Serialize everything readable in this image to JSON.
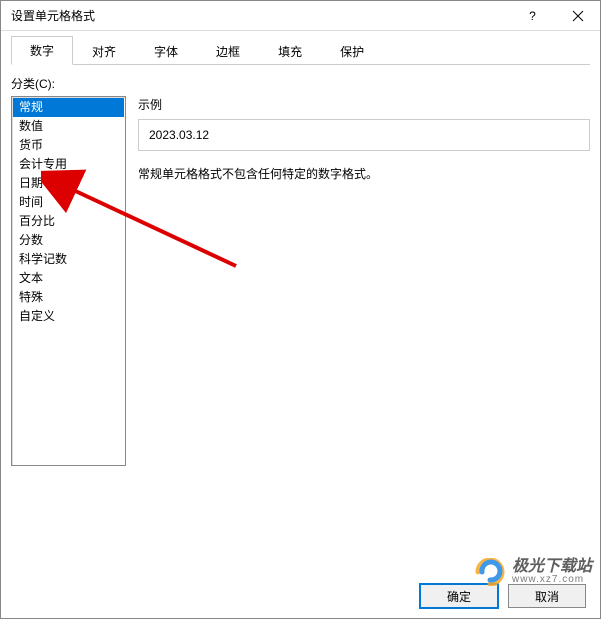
{
  "dialog": {
    "title": "设置单元格格式"
  },
  "tabs": {
    "items": [
      {
        "label": "数字"
      },
      {
        "label": "对齐"
      },
      {
        "label": "字体"
      },
      {
        "label": "边框"
      },
      {
        "label": "填充"
      },
      {
        "label": "保护"
      }
    ]
  },
  "category": {
    "label": "分类(C):",
    "items": [
      {
        "label": "常规"
      },
      {
        "label": "数值"
      },
      {
        "label": "货币"
      },
      {
        "label": "会计专用"
      },
      {
        "label": "日期"
      },
      {
        "label": "时间"
      },
      {
        "label": "百分比"
      },
      {
        "label": "分数"
      },
      {
        "label": "科学记数"
      },
      {
        "label": "文本"
      },
      {
        "label": "特殊"
      },
      {
        "label": "自定义"
      }
    ]
  },
  "sample": {
    "label": "示例",
    "value": "2023.03.12"
  },
  "description": "常规单元格格式不包含任何特定的数字格式。",
  "buttons": {
    "ok": "确定",
    "cancel": "取消"
  },
  "watermark": {
    "main": "极光下载站",
    "sub": "www.xz7.com"
  }
}
